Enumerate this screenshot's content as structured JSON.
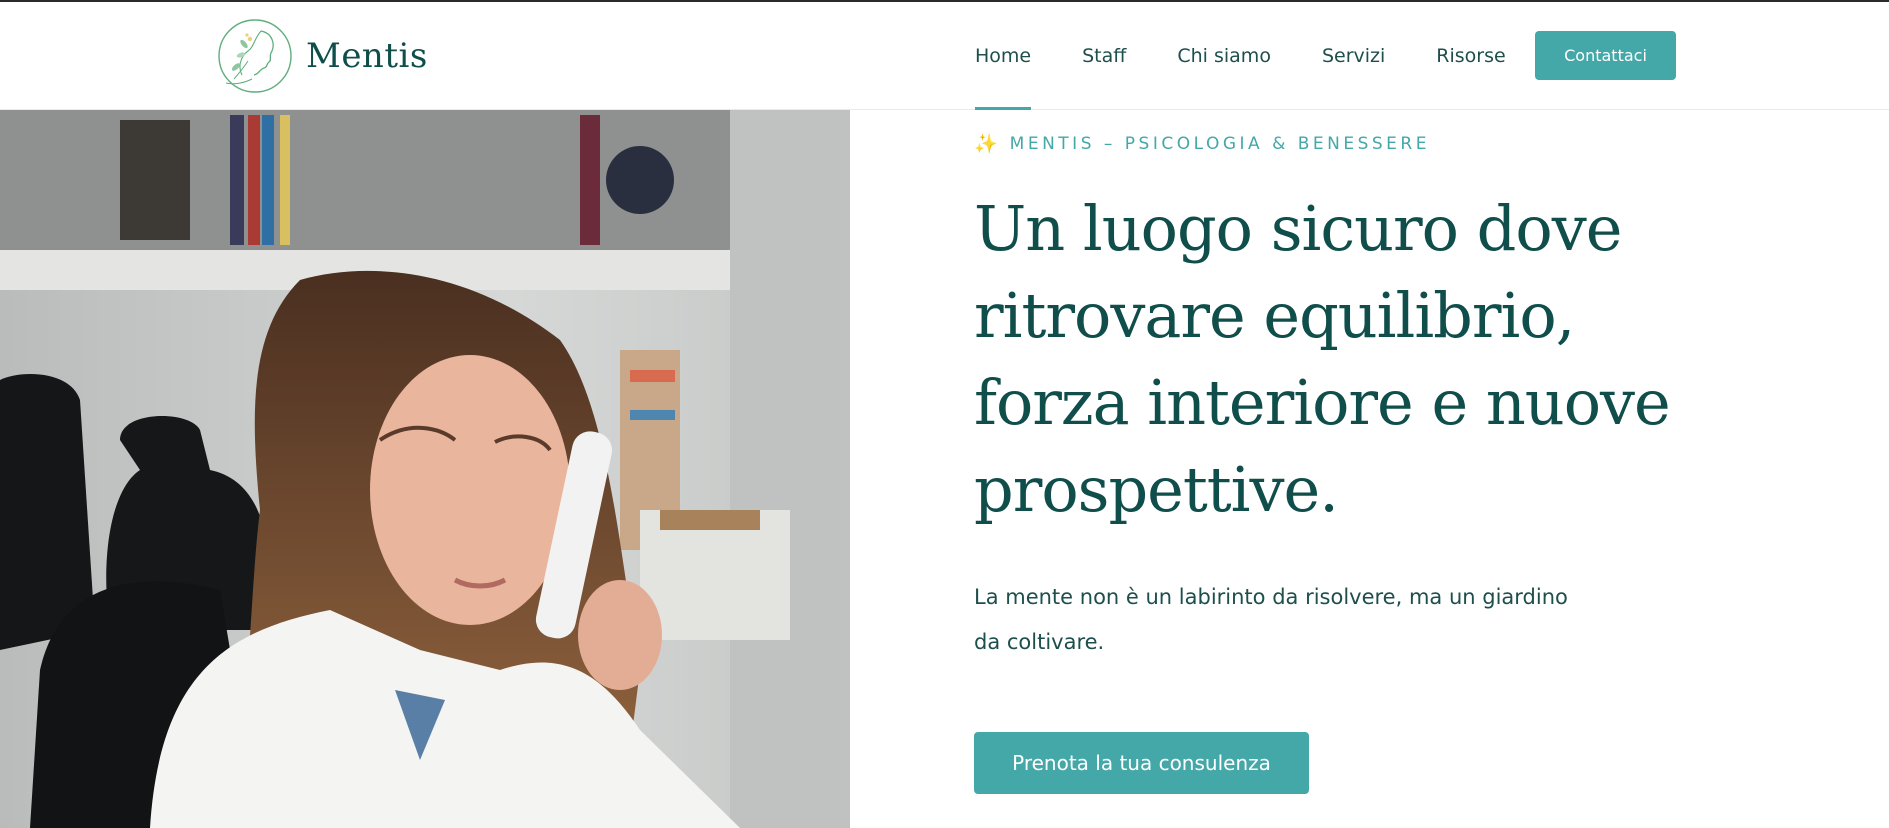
{
  "brand": {
    "name": "Mentis",
    "logo_icon": "woman-profile-leaf-logo"
  },
  "nav": {
    "items": [
      {
        "label": "Home",
        "active": true
      },
      {
        "label": "Staff"
      },
      {
        "label": "Chi siamo"
      },
      {
        "label": "Servizi"
      },
      {
        "label": "Risorse"
      }
    ],
    "cta_label": "Contattaci"
  },
  "hero": {
    "eyebrow_icon": "✨",
    "eyebrow": "MENTIS – PSICOLOGIA & BENESSERE",
    "headline": "Un luogo sicuro dove ritrovare equilibrio, forza interiore e nuove prospettive.",
    "lead": "La mente non è un labirinto da risolvere, ma un giardino da coltivare.",
    "cta_label": "Prenota la tua consulenza",
    "image_subject": "woman-on-phone-photo"
  },
  "colors": {
    "accent": "#44a7a8",
    "heading": "#0f4e4a",
    "text": "#1d4f4d",
    "sparkle": "#e8c33a"
  }
}
